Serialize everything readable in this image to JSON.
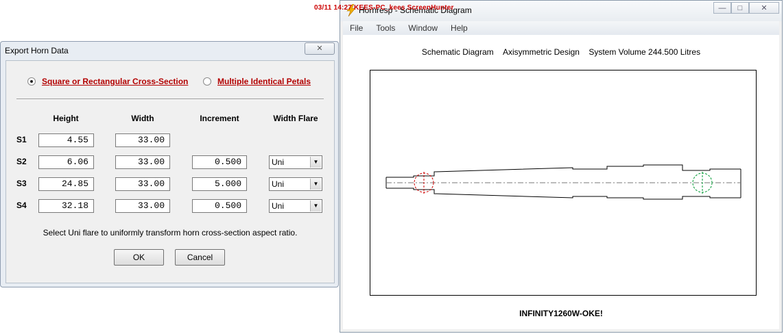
{
  "overlay": {
    "timestamp": "03/11  14:27 KEES-PC_kees  ScreenHunter"
  },
  "schematic_window": {
    "title": "Hornresp - Schematic Diagram",
    "menu": [
      "File",
      "Tools",
      "Window",
      "Help"
    ],
    "header": {
      "kind": "Schematic Diagram",
      "design": "Axisymmetric Design",
      "volume": "System Volume 244.500 Litres"
    },
    "record_name": "INFINITY1260W-OKE!",
    "driver_marker_color": "#cc0000",
    "port_marker_color": "#009933"
  },
  "dialog": {
    "title": "Export Horn Data",
    "close_icon": "close-icon",
    "radio_square": {
      "label": "Square or Rectangular Cross-Section",
      "selected": true
    },
    "radio_petals": {
      "label": "Multiple Identical Petals",
      "selected": false
    },
    "columns": {
      "height": "Height",
      "width": "Width",
      "increment": "Increment",
      "flare": "Width Flare"
    },
    "rows": [
      {
        "label": "S1",
        "height": "4.55",
        "width": "33.00",
        "increment": "",
        "flare": ""
      },
      {
        "label": "S2",
        "height": "6.06",
        "width": "33.00",
        "increment": "0.500",
        "flare": "Uni"
      },
      {
        "label": "S3",
        "height": "24.85",
        "width": "33.00",
        "increment": "5.000",
        "flare": "Uni"
      },
      {
        "label": "S4",
        "height": "32.18",
        "width": "33.00",
        "increment": "0.500",
        "flare": "Uni"
      }
    ],
    "hint": "Select Uni flare to uniformly transform horn cross-section aspect ratio.",
    "ok_label": "OK",
    "cancel_label": "Cancel"
  }
}
